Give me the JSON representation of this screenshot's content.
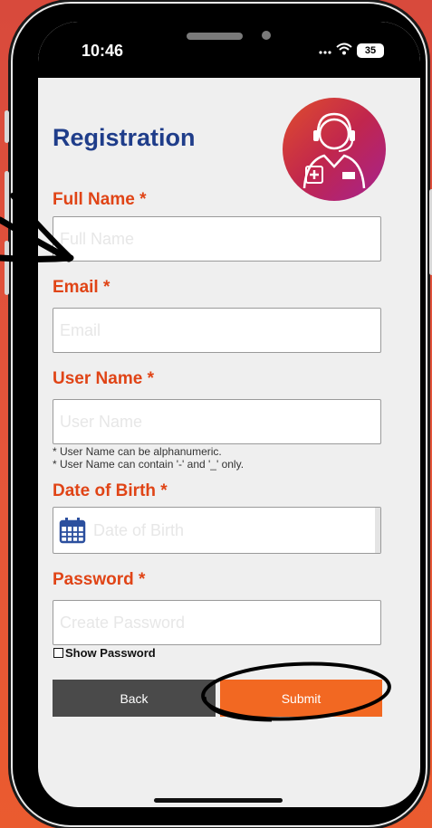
{
  "status_bar": {
    "time": "10:46",
    "signal_icon": "signal-icon",
    "wifi_icon": "wifi-icon",
    "battery": "35"
  },
  "page": {
    "title": "Registration"
  },
  "form": {
    "full_name": {
      "label": "Full Name",
      "required_mark": "*",
      "placeholder": "Full Name",
      "value": ""
    },
    "email": {
      "label": "Email",
      "required_mark": "*",
      "placeholder": "Email",
      "value": ""
    },
    "username": {
      "label": "User Name",
      "required_mark": "*",
      "placeholder": "User Name",
      "value": "",
      "hints": [
        "* User Name can be alphanumeric.",
        "* User Name can contain '-' and '_' only."
      ]
    },
    "dob": {
      "label": "Date of Birth",
      "required_mark": "*",
      "placeholder": "Date of Birth",
      "value": "",
      "icon": "calendar-icon"
    },
    "password": {
      "label": "Password",
      "required_mark": "*",
      "placeholder": "Create Password",
      "value": "",
      "show_password_label": "Show Password",
      "show_password_checked": false
    }
  },
  "buttons": {
    "back": "Back",
    "submit": "Submit"
  },
  "colors": {
    "title": "#1f3d8a",
    "label": "#e04416",
    "back_button": "#4a4a4a",
    "submit_button": "#f26822",
    "background": "#efefef"
  },
  "annotations": {
    "arrow_icon": "hand-drawn-arrow-icon",
    "circle_icon": "hand-drawn-circle-icon"
  }
}
